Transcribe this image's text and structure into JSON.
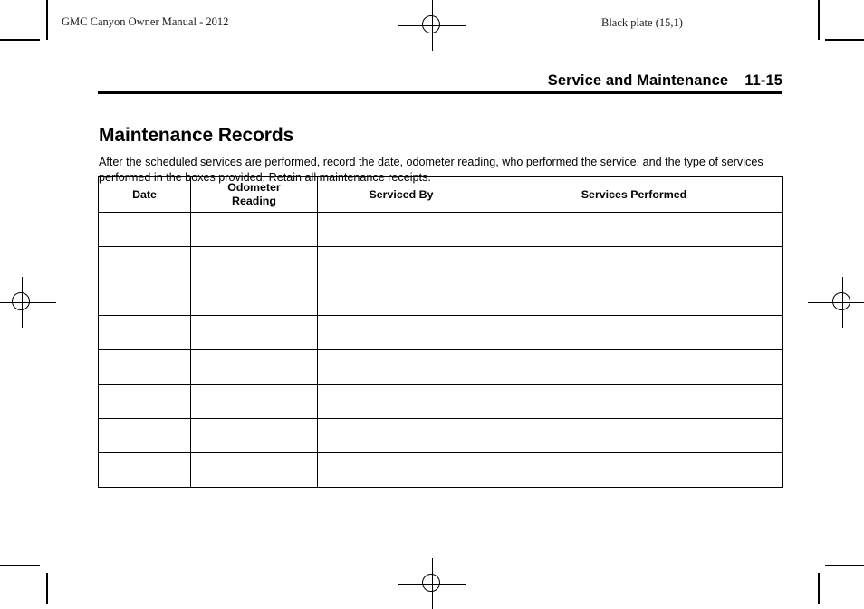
{
  "page": {
    "manual_title": "GMC Canyon Owner Manual - 2012",
    "plate_note": "Black plate (15,1)",
    "section_title": "Service and Maintenance",
    "page_number": "11-15"
  },
  "article": {
    "heading": "Maintenance Records",
    "body": "After the scheduled services are performed, record the date, odometer reading, who performed the service, and the type of services performed in the boxes provided. Retain all maintenance receipts."
  },
  "records_table": {
    "columns": [
      {
        "label": "Date"
      },
      {
        "label": "Odometer\nReading",
        "line1": "Odometer",
        "line2": "Reading"
      },
      {
        "label": "Serviced By"
      },
      {
        "label": "Services Performed"
      }
    ],
    "row_count": 8,
    "rows": [
      {
        "date": "",
        "odometer": "",
        "serviced_by": "",
        "services_performed": ""
      },
      {
        "date": "",
        "odometer": "",
        "serviced_by": "",
        "services_performed": ""
      },
      {
        "date": "",
        "odometer": "",
        "serviced_by": "",
        "services_performed": ""
      },
      {
        "date": "",
        "odometer": "",
        "serviced_by": "",
        "services_performed": ""
      },
      {
        "date": "",
        "odometer": "",
        "serviced_by": "",
        "services_performed": ""
      },
      {
        "date": "",
        "odometer": "",
        "serviced_by": "",
        "services_performed": ""
      },
      {
        "date": "",
        "odometer": "",
        "serviced_by": "",
        "services_performed": ""
      },
      {
        "date": "",
        "odometer": "",
        "serviced_by": "",
        "services_performed": ""
      }
    ]
  },
  "print_marks": {
    "registration_icon": "registration-crosshair-icon",
    "corner_icon": "corner-crop-mark-icon"
  }
}
